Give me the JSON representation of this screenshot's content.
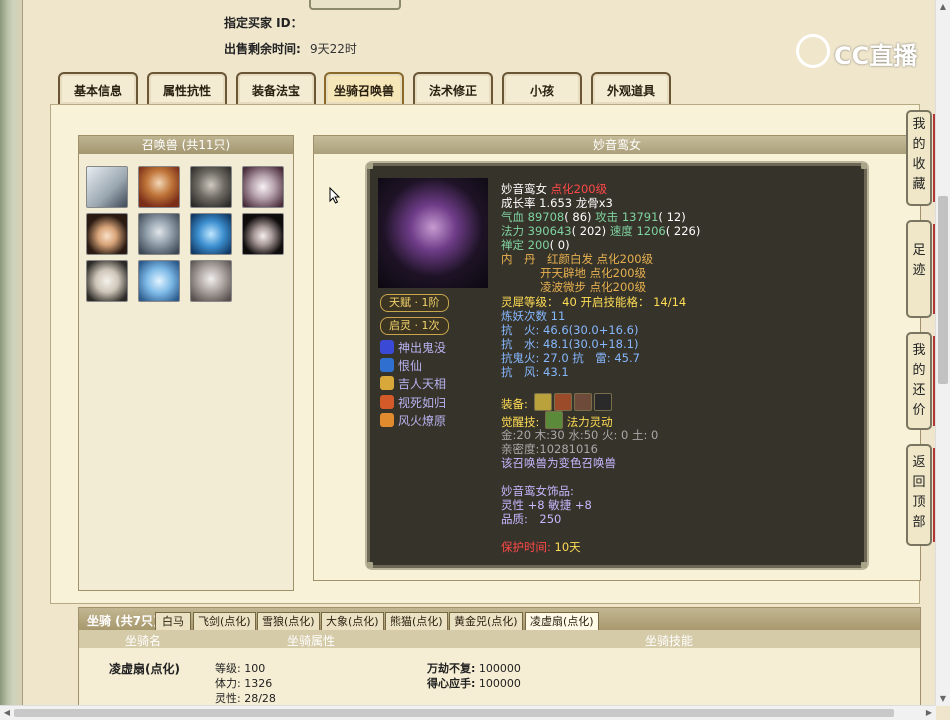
{
  "header": {
    "buyer_label": "指定买家 ID：",
    "buyer_value": "",
    "remain_label": "出售剩余时间:",
    "remain_value": "9天22时",
    "logo_text": "CC直播"
  },
  "tabs": [
    {
      "label": "基本信息"
    },
    {
      "label": "属性抗性"
    },
    {
      "label": "装备法宝"
    },
    {
      "label": "坐骑召唤兽",
      "active": true
    },
    {
      "label": "法术修正"
    },
    {
      "label": "小孩"
    },
    {
      "label": "外观道具"
    }
  ],
  "summons": {
    "title": "召唤兽 (共11只)",
    "avatars": [
      "polar-bear",
      "goddess",
      "warrior",
      "white-tiger",
      "doll",
      "masked-fairy",
      "blue-spirit",
      "white-cat",
      "panda",
      "ice-crystal",
      "silver-maiden"
    ]
  },
  "detail": {
    "title": "妙音鸾女",
    "talent_pill": "天赋 · 1阶",
    "awaken_pill": "启灵 · 1次",
    "skills": [
      "神出鬼没",
      "恨仙",
      "吉人天相",
      "视死如归",
      "风火燎原"
    ],
    "name": "妙音鸾女",
    "level": "点化200级",
    "growth_label": "成长率",
    "growth_value": "1.653",
    "dragon_bone": "龙骨x3",
    "hp_label": "气血",
    "hp_value": "89708",
    "hp_extra": "( 86)",
    "atk_label": "攻击",
    "atk_value": "13791",
    "atk_extra": "( 12)",
    "mp_label": "法力",
    "mp_value": "390643",
    "mp_extra": "( 202)",
    "spd_label": "速度",
    "spd_value": "1206",
    "spd_extra": "( 226)",
    "calm_label": "禅定",
    "calm_value": "200",
    "calm_extra": "( 0)",
    "neidan_label": "内　丹",
    "neidan": [
      "红颜白发 点化200级",
      "开天辟地 点化200级",
      "凌波微步 点化200级"
    ],
    "lingxi_label": "灵犀等级：",
    "lingxi_value": "40",
    "open_label": "开启技能格：",
    "open_value": "14/14",
    "refine_label": "炼妖次数",
    "refine_value": "11",
    "res_fire": "抗　火: 46.6(30.0+16.6)",
    "res_water": "抗　水: 48.1(30.0+18.1)",
    "res_ghost": "抗鬼火: 27.0 抗　雷: 45.7",
    "res_wind": "抗　风: 43.1",
    "equip_label": "装备:",
    "awake_label": "觉醒技:",
    "awake_value": "法力灵动",
    "elements": "金:20 木:30 水:50 火: 0 土: 0",
    "intimacy": "亲密度:10281016",
    "variant": "该召唤兽为变色召唤兽",
    "ornament_label": "妙音鸾女饰品:",
    "ornament_stats": "灵性 +8 敏捷 +8",
    "ornament_quality": "品质:　250",
    "protect_label": "保护时间:",
    "protect_value": "10天"
  },
  "side_buttons": [
    {
      "label": "我的收藏"
    },
    {
      "label": "足迹"
    },
    {
      "label": "我的还价"
    },
    {
      "label": "返回顶部"
    }
  ],
  "mount": {
    "title": "坐骑 (共7只)",
    "tabs": [
      "白马",
      "飞剑(点化)",
      "雪狼(点化)",
      "大象(点化)",
      "熊猫(点化)",
      "黄金兕(点化)",
      "凌虚扇(点化)"
    ],
    "col_name": "坐骑名",
    "col_attr": "坐骑属性",
    "col_skill": "坐骑技能",
    "row_name": "凌虚扇(点化)",
    "attrs": [
      "等级: 100",
      "体力: 1326",
      "灵性: 28/28"
    ],
    "skills": [
      {
        "label": "万劫不复:",
        "value": "100000"
      },
      {
        "label": "得心应手:",
        "value": "100000"
      }
    ]
  }
}
